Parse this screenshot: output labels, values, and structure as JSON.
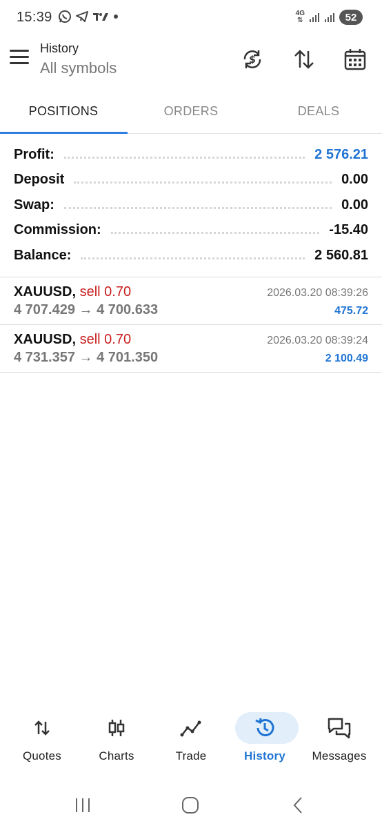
{
  "status_bar": {
    "time": "15:39",
    "network": "4G",
    "battery": "52",
    "icons": [
      "whatsapp-icon",
      "telegram-icon",
      "tradingview-icon",
      "dot-icon",
      "signal-icon",
      "signal-icon"
    ]
  },
  "header": {
    "title": "History",
    "subtitle": "All symbols",
    "icons": [
      "menu-icon",
      "currency-refresh-icon",
      "sort-icon",
      "calendar-icon"
    ]
  },
  "tabs": [
    {
      "label": "POSITIONS",
      "active": true
    },
    {
      "label": "ORDERS",
      "active": false
    },
    {
      "label": "DEALS",
      "active": false
    }
  ],
  "summary": [
    {
      "label": "Profit:",
      "value": "2 576.21"
    },
    {
      "label": "Deposit",
      "value": "0.00"
    },
    {
      "label": "Swap:",
      "value": "0.00"
    },
    {
      "label": "Commission:",
      "value": "-15.40"
    },
    {
      "label": "Balance:",
      "value": "2 560.81"
    }
  ],
  "positions": [
    {
      "symbol": "XAUUSD,",
      "side": "sell 0.70",
      "prices": "4 707.429 → 4 700.633",
      "time": "2026.03.20 08:39:26",
      "profit": "475.72"
    },
    {
      "symbol": "XAUUSD,",
      "side": "sell 0.70",
      "prices": "4 731.357 → 4 701.350",
      "time": "2026.03.20 08:39:24",
      "profit": "2 100.49"
    }
  ],
  "bottom_nav": [
    {
      "label": "Quotes",
      "icon": "quotes-icon",
      "active": false
    },
    {
      "label": "Charts",
      "icon": "candlestick-icon",
      "active": false
    },
    {
      "label": "Trade",
      "icon": "trade-icon",
      "active": false
    },
    {
      "label": "History",
      "icon": "history-icon",
      "active": true
    },
    {
      "label": "Messages",
      "icon": "messages-icon",
      "active": false
    }
  ],
  "colors": {
    "accent": "#1f74d4",
    "sell": "#c81e1e",
    "active_pill": "#e3eefb"
  }
}
